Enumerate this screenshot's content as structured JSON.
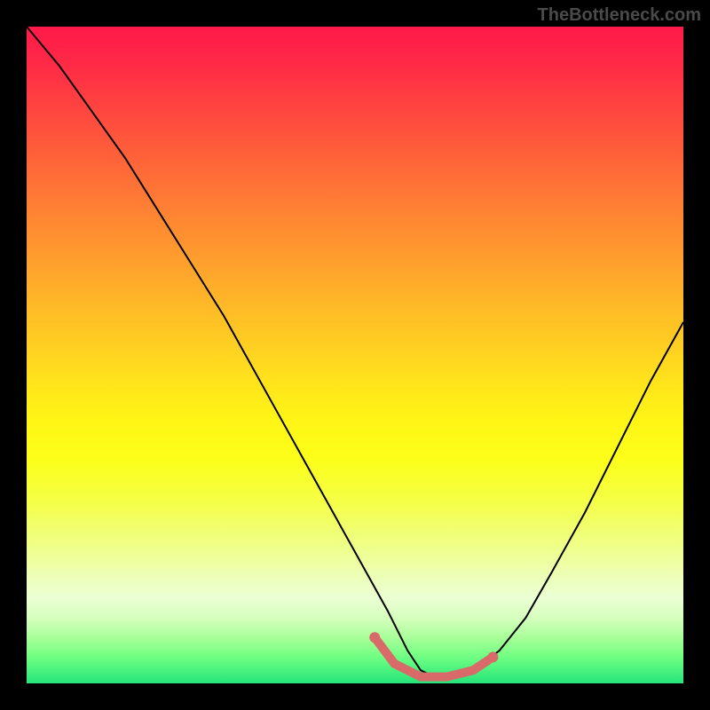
{
  "watermark": "TheBottleneck.com",
  "colors": {
    "curve": "#000000",
    "highlight": "#d96a6a",
    "background": "#000000"
  },
  "chart_data": {
    "type": "line",
    "title": "",
    "xlabel": "",
    "ylabel": "",
    "xrange": [
      0,
      100
    ],
    "yrange": [
      0,
      100
    ],
    "description": "Bottleneck percentage curve over a red-to-green vertical gradient. Valley near x≈60 marks optimal balance (lowest bottleneck). Highlighted segment marks recommended range.",
    "series": [
      {
        "name": "bottleneck-curve",
        "x": [
          0,
          5,
          10,
          15,
          20,
          25,
          30,
          35,
          40,
          45,
          50,
          55,
          58,
          60,
          62,
          65,
          68,
          72,
          76,
          80,
          85,
          90,
          95,
          100
        ],
        "y": [
          100,
          94,
          87,
          80,
          72,
          64,
          56,
          47,
          38,
          29,
          20,
          11,
          5,
          2,
          1,
          1,
          2,
          5,
          10,
          17,
          26,
          36,
          46,
          55
        ]
      }
    ],
    "highlight": {
      "name": "optimal-range",
      "x": [
        53,
        56,
        60,
        64,
        68,
        71
      ],
      "y": [
        7,
        3,
        1,
        1,
        2,
        4
      ]
    },
    "gradient_stops": [
      {
        "pos": 0.0,
        "color": "#ff194a"
      },
      {
        "pos": 0.5,
        "color": "#ffe31c"
      },
      {
        "pos": 0.78,
        "color": "#f0ff7e"
      },
      {
        "pos": 1.0,
        "color": "#25e47a"
      }
    ]
  }
}
